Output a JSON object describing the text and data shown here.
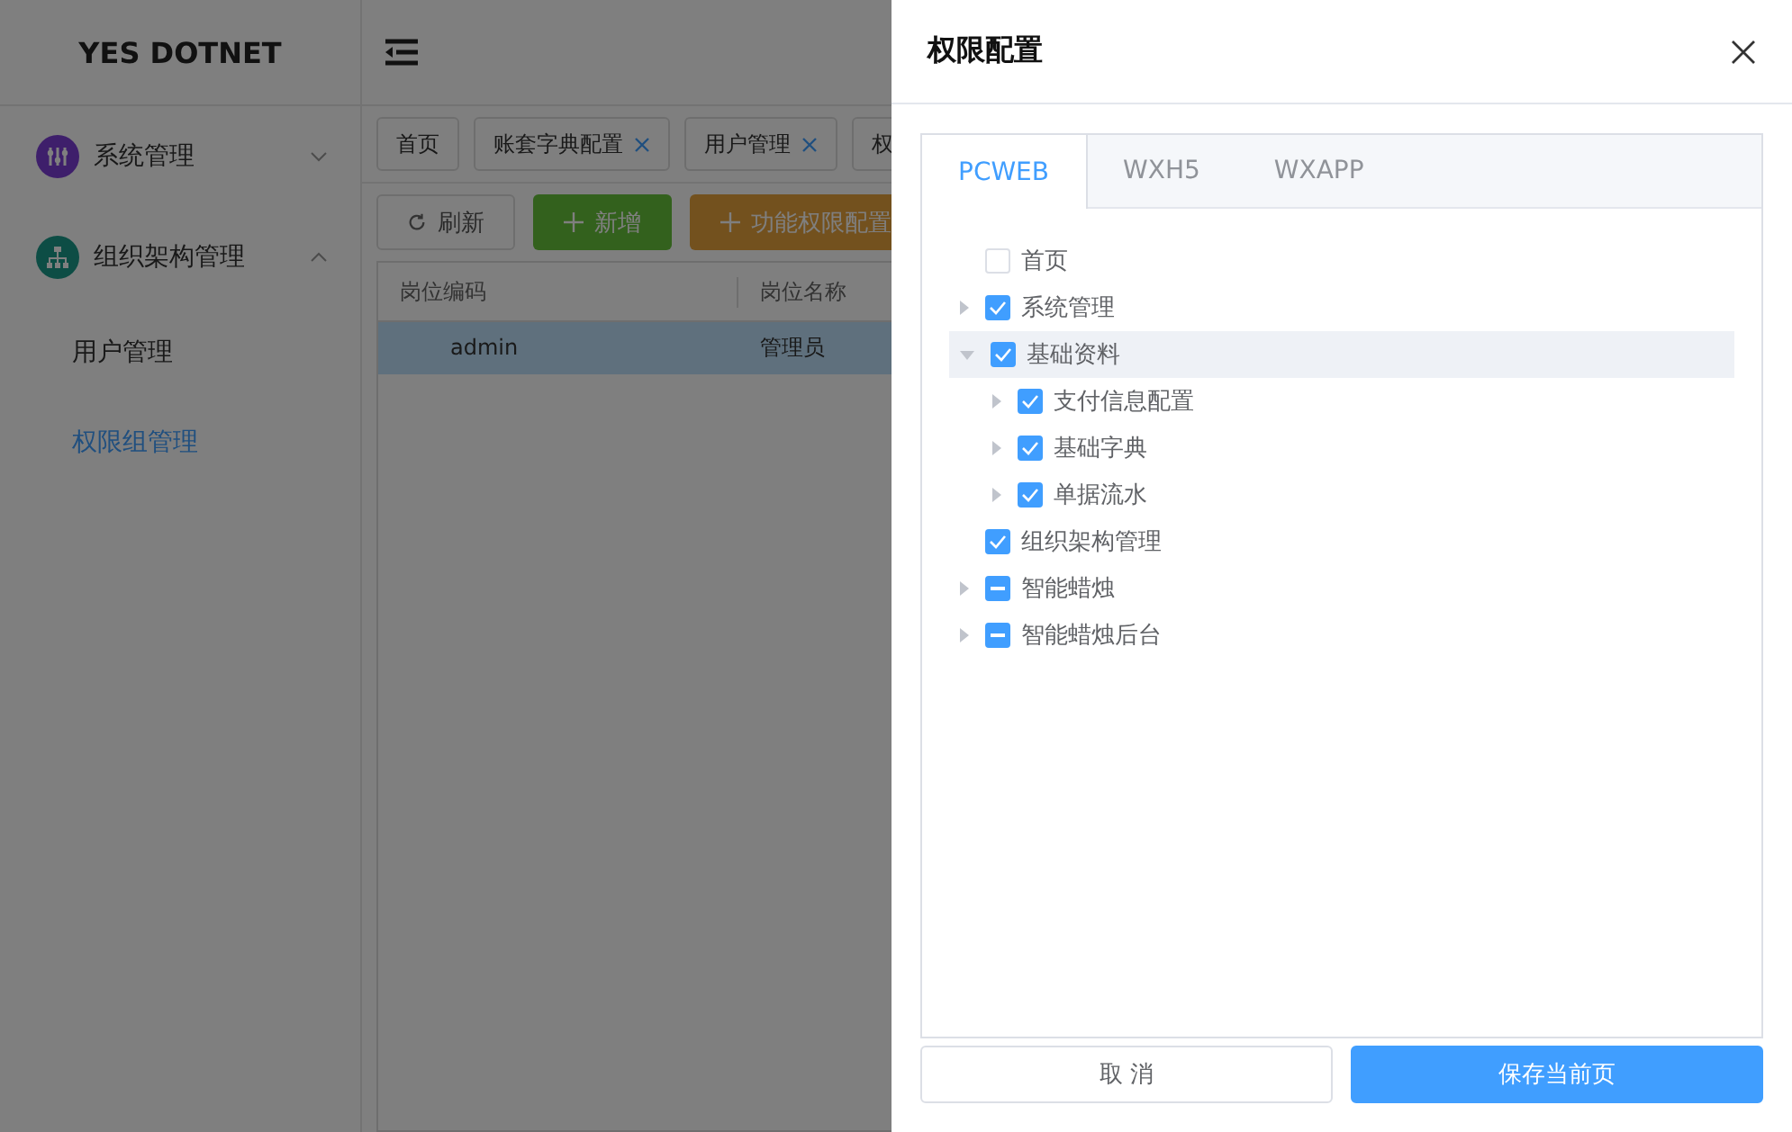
{
  "brand": "YES DOTNET",
  "sidebar": {
    "items": [
      {
        "label": "系统管理",
        "kind": "group",
        "expanded": false,
        "selected": false
      },
      {
        "label": "组织架构管理",
        "kind": "group",
        "expanded": true,
        "selected": false
      },
      {
        "label": "用户管理",
        "kind": "link",
        "selected": false
      },
      {
        "label": "权限组管理",
        "kind": "link",
        "selected": true
      }
    ]
  },
  "page_tabs": [
    {
      "label": "首页",
      "closable": false
    },
    {
      "label": "账套字典配置",
      "closable": true
    },
    {
      "label": "用户管理",
      "closable": true
    },
    {
      "label": "权",
      "closable": false
    }
  ],
  "toolbar": [
    {
      "label": "刷新",
      "kind": "refresh"
    },
    {
      "label": "新增",
      "kind": "add"
    },
    {
      "label": "功能权限配置",
      "kind": "config"
    }
  ],
  "table": {
    "columns": [
      "岗位编码",
      "岗位名称"
    ],
    "rows": [
      {
        "cells": [
          "admin",
          "管理员"
        ],
        "selected": true
      }
    ]
  },
  "drawer": {
    "title": "权限配置",
    "tabs": [
      {
        "label": "PCWEB",
        "selected": true
      },
      {
        "label": "WXH5",
        "selected": false
      },
      {
        "label": "WXAPP",
        "selected": false
      }
    ],
    "tree": [
      {
        "label": "首页",
        "checked": false,
        "indeterminate": false,
        "leaf": true,
        "expanded": false,
        "selected": false
      },
      {
        "label": "系统管理",
        "checked": true,
        "indeterminate": false,
        "leaf": false,
        "expanded": false,
        "selected": false
      },
      {
        "label": "基础资料",
        "checked": true,
        "indeterminate": false,
        "leaf": false,
        "expanded": true,
        "selected": true,
        "children": [
          {
            "label": "支付信息配置",
            "checked": true,
            "indeterminate": false,
            "leaf": false,
            "expanded": false,
            "selected": false
          },
          {
            "label": "基础字典",
            "checked": true,
            "indeterminate": false,
            "leaf": false,
            "expanded": false,
            "selected": false
          },
          {
            "label": "单据流水",
            "checked": true,
            "indeterminate": false,
            "leaf": false,
            "expanded": false,
            "selected": false
          }
        ]
      },
      {
        "label": "组织架构管理",
        "checked": true,
        "indeterminate": false,
        "leaf": true,
        "expanded": false,
        "selected": false
      },
      {
        "label": "智能蜡烛",
        "checked": false,
        "indeterminate": true,
        "leaf": false,
        "expanded": false,
        "selected": false
      },
      {
        "label": "智能蜡烛后台",
        "checked": false,
        "indeterminate": true,
        "leaf": false,
        "expanded": false,
        "selected": false
      }
    ],
    "buttons": [
      {
        "label": "取 消",
        "kind": "cancel"
      },
      {
        "label": "保存当前页",
        "kind": "primary"
      }
    ]
  }
}
